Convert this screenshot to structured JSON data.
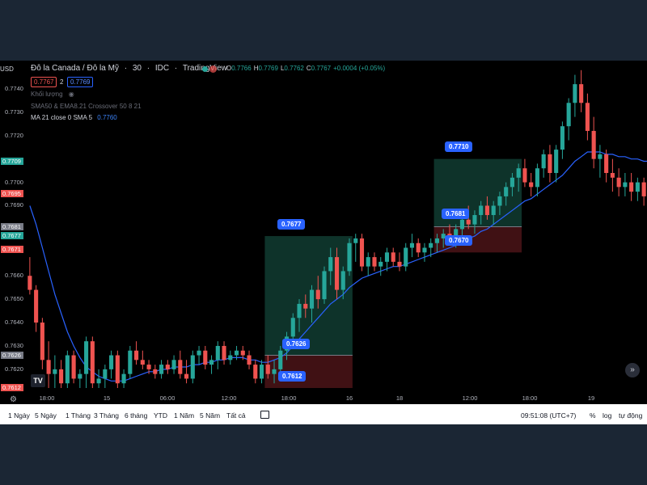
{
  "header": {
    "symbol": "Đô la Canada / Đô la Mỹ",
    "interval": "30",
    "exchange": "IDC",
    "platform": "TradingView",
    "ohlc": [
      {
        "k": "O",
        "v": "0.7766"
      },
      {
        "k": "H",
        "v": "0.7769"
      },
      {
        "k": "L",
        "v": "0.7762"
      },
      {
        "k": "C",
        "v": "0.7767"
      },
      {
        "k": "",
        "v": "+0.0004 (+0.05%)"
      }
    ],
    "sell_price": "0.7767",
    "spread": "2",
    "buy_price": "0.7769"
  },
  "indicators": {
    "volume": "Khối lượng",
    "sma_ema": "SMA50 & EMA8.21 Crossover 50 8 21",
    "ma_label": "MA 21 close 0 SMA 5",
    "ma_value": "0.7760"
  },
  "price_scale": {
    "currency": "USD",
    "ticks": [
      "0.7740",
      "0.7730",
      "0.7720",
      "0.7700",
      "0.7690",
      "0.7660",
      "0.7650",
      "0.7640",
      "0.7630",
      "0.7620"
    ],
    "tagged": [
      {
        "v": "0.7709",
        "color": "#26a69a"
      },
      {
        "v": "0.7695",
        "color": "#ef5350"
      },
      {
        "v": "0.7681",
        "color": "#787b86"
      },
      {
        "v": "0.7677",
        "color": "#26a69a"
      },
      {
        "v": "0.7671",
        "color": "#ef5350"
      },
      {
        "v": "0.7626",
        "color": "#787b86"
      },
      {
        "v": "0.7612",
        "color": "#ef5350"
      }
    ]
  },
  "time_axis": [
    "18:00",
    "15",
    "06:00",
    "12:00",
    "18:00",
    "16",
    "18",
    "12:00",
    "18:00",
    "19"
  ],
  "positions": [
    {
      "entry": "0.7626",
      "target": "0.7677",
      "stop": "0.7612"
    },
    {
      "entry": "0.7681",
      "target": "0.7710",
      "stop": "0.7670"
    }
  ],
  "toolbar": {
    "timeframes": [
      "1 Ngày",
      "5 Ngày",
      "1 Tháng",
      "3 Tháng",
      "6 tháng",
      "YTD",
      "1 Năm",
      "5 Năm",
      "Tất cả"
    ],
    "clock": "09:51:08 (UTC+7)",
    "percent": "%",
    "log": "log",
    "auto": "tự động"
  },
  "colors": {
    "up": "#26a69a",
    "down": "#ef5350",
    "ma": "#2962ff",
    "accent": "#2962ff"
  },
  "icons": {
    "logo": "tradingview-logo-icon",
    "settings": "gear-icon",
    "scroll": "chevron-double-right-icon",
    "calendar": "calendar-icon"
  },
  "chart_data": {
    "type": "candlestick",
    "ylim": [
      0.7612,
      0.775
    ],
    "candles": [
      [
        0.766,
        0.7668,
        0.7652,
        0.7654
      ],
      [
        0.7654,
        0.7656,
        0.7636,
        0.764
      ],
      [
        0.764,
        0.7642,
        0.762,
        0.7624
      ],
      [
        0.7624,
        0.7632,
        0.7612,
        0.7618
      ],
      [
        0.7618,
        0.7626,
        0.7612,
        0.762
      ],
      [
        0.762,
        0.7624,
        0.7612,
        0.7614
      ],
      [
        0.7614,
        0.7628,
        0.7612,
        0.7626
      ],
      [
        0.7626,
        0.7628,
        0.7614,
        0.7616
      ],
      [
        0.7616,
        0.762,
        0.7612,
        0.7618
      ],
      [
        0.7618,
        0.7634,
        0.7612,
        0.7632
      ],
      [
        0.7632,
        0.7634,
        0.7612,
        0.7614
      ],
      [
        0.7614,
        0.762,
        0.7612,
        0.7616
      ],
      [
        0.7616,
        0.7622,
        0.7612,
        0.762
      ],
      [
        0.762,
        0.7628,
        0.7616,
        0.7626
      ],
      [
        0.7626,
        0.7628,
        0.7612,
        0.7614
      ],
      [
        0.7614,
        0.762,
        0.7612,
        0.7618
      ],
      [
        0.7618,
        0.763,
        0.7616,
        0.7628
      ],
      [
        0.7628,
        0.7632,
        0.7622,
        0.7624
      ],
      [
        0.7624,
        0.7628,
        0.762,
        0.7622
      ],
      [
        0.7622,
        0.7624,
        0.7618,
        0.762
      ],
      [
        0.762,
        0.7622,
        0.7616,
        0.7618
      ],
      [
        0.7618,
        0.7624,
        0.7616,
        0.7622
      ],
      [
        0.7622,
        0.7624,
        0.7618,
        0.762
      ],
      [
        0.762,
        0.7626,
        0.7618,
        0.7624
      ],
      [
        0.7624,
        0.7628,
        0.7616,
        0.7618
      ],
      [
        0.7618,
        0.7624,
        0.7614,
        0.7616
      ],
      [
        0.7616,
        0.7628,
        0.7614,
        0.7626
      ],
      [
        0.7626,
        0.763,
        0.7622,
        0.7628
      ],
      [
        0.7628,
        0.763,
        0.762,
        0.7622
      ],
      [
        0.7622,
        0.7626,
        0.7618,
        0.7624
      ],
      [
        0.7624,
        0.7632,
        0.762,
        0.763
      ],
      [
        0.763,
        0.7632,
        0.7622,
        0.7624
      ],
      [
        0.7624,
        0.7628,
        0.7622,
        0.7626
      ],
      [
        0.7626,
        0.763,
        0.7624,
        0.7628
      ],
      [
        0.7628,
        0.763,
        0.7624,
        0.7626
      ],
      [
        0.7626,
        0.7628,
        0.762,
        0.7622
      ],
      [
        0.7622,
        0.7624,
        0.7614,
        0.7616
      ],
      [
        0.7616,
        0.7624,
        0.7614,
        0.7622
      ],
      [
        0.7622,
        0.7626,
        0.7616,
        0.7618
      ],
      [
        0.7618,
        0.7624,
        0.7614,
        0.762
      ],
      [
        0.762,
        0.763,
        0.7618,
        0.7628
      ],
      [
        0.7628,
        0.7636,
        0.7624,
        0.7634
      ],
      [
        0.7634,
        0.7644,
        0.7632,
        0.7642
      ],
      [
        0.7642,
        0.765,
        0.7636,
        0.7648
      ],
      [
        0.7648,
        0.7652,
        0.7642,
        0.7646
      ],
      [
        0.7646,
        0.7656,
        0.764,
        0.7654
      ],
      [
        0.7654,
        0.766,
        0.7646,
        0.765
      ],
      [
        0.765,
        0.7664,
        0.7648,
        0.7662
      ],
      [
        0.7662,
        0.7672,
        0.7656,
        0.7668
      ],
      [
        0.7668,
        0.7672,
        0.765,
        0.7654
      ],
      [
        0.7654,
        0.7664,
        0.765,
        0.7662
      ],
      [
        0.7662,
        0.7676,
        0.766,
        0.7674
      ],
      [
        0.7674,
        0.7678,
        0.7666,
        0.7676
      ],
      [
        0.7676,
        0.7678,
        0.7662,
        0.7664
      ],
      [
        0.7664,
        0.767,
        0.766,
        0.7668
      ],
      [
        0.7668,
        0.767,
        0.7662,
        0.7664
      ],
      [
        0.7664,
        0.7668,
        0.766,
        0.7666
      ],
      [
        0.7666,
        0.7672,
        0.7662,
        0.767
      ],
      [
        0.767,
        0.7672,
        0.7664,
        0.7666
      ],
      [
        0.7666,
        0.767,
        0.7662,
        0.7664
      ],
      [
        0.7664,
        0.7674,
        0.7662,
        0.7672
      ],
      [
        0.7672,
        0.7678,
        0.7668,
        0.7674
      ],
      [
        0.7674,
        0.7676,
        0.7668,
        0.767
      ],
      [
        0.767,
        0.7674,
        0.7666,
        0.7672
      ],
      [
        0.7672,
        0.7676,
        0.7668,
        0.7674
      ],
      [
        0.7674,
        0.7678,
        0.767,
        0.7676
      ],
      [
        0.7676,
        0.768,
        0.7672,
        0.7678
      ],
      [
        0.7678,
        0.7682,
        0.7674,
        0.7676
      ],
      [
        0.7676,
        0.7682,
        0.7672,
        0.768
      ],
      [
        0.768,
        0.7686,
        0.7676,
        0.7684
      ],
      [
        0.7684,
        0.769,
        0.768,
        0.7682
      ],
      [
        0.7682,
        0.7688,
        0.7678,
        0.7686
      ],
      [
        0.7686,
        0.7692,
        0.7682,
        0.769
      ],
      [
        0.769,
        0.7694,
        0.7684,
        0.7686
      ],
      [
        0.7686,
        0.7692,
        0.7682,
        0.769
      ],
      [
        0.769,
        0.7696,
        0.7686,
        0.7694
      ],
      [
        0.7694,
        0.77,
        0.769,
        0.7698
      ],
      [
        0.7698,
        0.7704,
        0.7694,
        0.7702
      ],
      [
        0.7702,
        0.7708,
        0.7696,
        0.7706
      ],
      [
        0.7706,
        0.771,
        0.7698,
        0.77
      ],
      [
        0.77,
        0.7704,
        0.7694,
        0.7698
      ],
      [
        0.7698,
        0.7708,
        0.7694,
        0.7706
      ],
      [
        0.7706,
        0.7714,
        0.7702,
        0.7712
      ],
      [
        0.7712,
        0.7716,
        0.77,
        0.7704
      ],
      [
        0.7704,
        0.7716,
        0.77,
        0.7714
      ],
      [
        0.7714,
        0.7726,
        0.771,
        0.7724
      ],
      [
        0.7724,
        0.7736,
        0.7718,
        0.7734
      ],
      [
        0.7734,
        0.7746,
        0.7728,
        0.7742
      ],
      [
        0.7742,
        0.7748,
        0.773,
        0.7734
      ],
      [
        0.7734,
        0.7738,
        0.7718,
        0.7722
      ],
      [
        0.7722,
        0.7728,
        0.7706,
        0.771
      ],
      [
        0.771,
        0.7716,
        0.7702,
        0.7712
      ],
      [
        0.7712,
        0.7714,
        0.77,
        0.7704
      ],
      [
        0.7704,
        0.771,
        0.7696,
        0.7702
      ],
      [
        0.7702,
        0.7706,
        0.7694,
        0.7698
      ],
      [
        0.7698,
        0.7704,
        0.7694,
        0.77
      ],
      [
        0.77,
        0.7704,
        0.7692,
        0.7696
      ],
      [
        0.7696,
        0.7702,
        0.7692,
        0.77
      ],
      [
        0.77,
        0.7702,
        0.769,
        0.7694
      ]
    ],
    "ma": [
      0.769,
      0.7682,
      0.7672,
      0.7662,
      0.7652,
      0.7644,
      0.7636,
      0.763,
      0.7625,
      0.7621,
      0.7619,
      0.7617,
      0.7616,
      0.7615,
      0.7615,
      0.7615,
      0.7616,
      0.7617,
      0.7618,
      0.7619,
      0.7619,
      0.762,
      0.762,
      0.7621,
      0.7621,
      0.7621,
      0.7622,
      0.7622,
      0.7623,
      0.7623,
      0.7624,
      0.7624,
      0.7625,
      0.7625,
      0.7625,
      0.7624,
      0.7624,
      0.7623,
      0.7623,
      0.7624,
      0.7625,
      0.7627,
      0.763,
      0.7633,
      0.7636,
      0.7639,
      0.7642,
      0.7645,
      0.7648,
      0.765,
      0.7652,
      0.7655,
      0.7657,
      0.7659,
      0.766,
      0.7661,
      0.7662,
      0.7663,
      0.7664,
      0.7664,
      0.7665,
      0.7666,
      0.7667,
      0.7668,
      0.7669,
      0.767,
      0.7671,
      0.7672,
      0.7673,
      0.7674,
      0.7676,
      0.7677,
      0.7679,
      0.768,
      0.7682,
      0.7684,
      0.7686,
      0.7688,
      0.769,
      0.7692,
      0.7693,
      0.7695,
      0.7697,
      0.7699,
      0.7701,
      0.7703,
      0.7706,
      0.7709,
      0.7711,
      0.7713,
      0.7713,
      0.7713,
      0.7712,
      0.7712,
      0.7711,
      0.7711,
      0.771,
      0.771,
      0.7709,
      0.7709
    ]
  }
}
